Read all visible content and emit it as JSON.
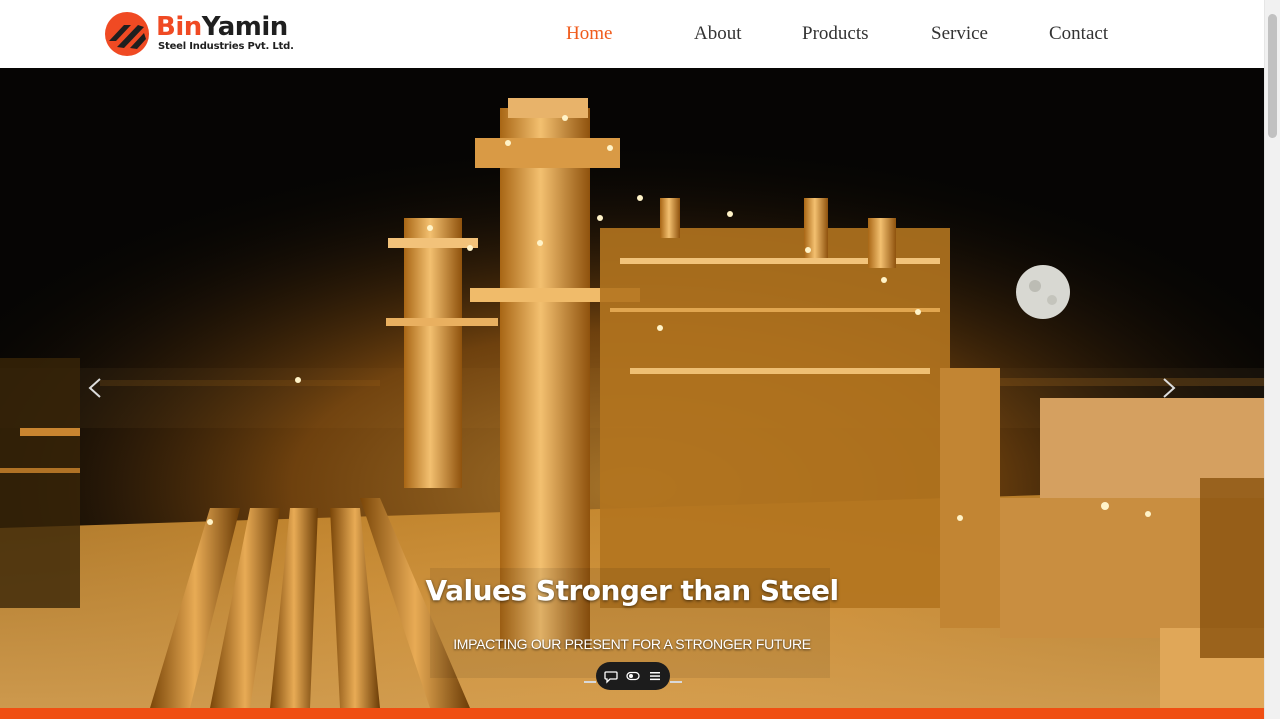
{
  "brand": {
    "name_part1": "Bin",
    "name_part2": "Yamin",
    "subtitle": "Steel Industries Pvt. Ltd."
  },
  "nav": {
    "items": [
      {
        "label": "Home",
        "active": true
      },
      {
        "label": "About",
        "active": false
      },
      {
        "label": "Products",
        "active": false
      },
      {
        "label": "Service",
        "active": false
      },
      {
        "label": "Contact",
        "active": false
      }
    ]
  },
  "hero": {
    "title": "Values Stronger than Steel",
    "subtitle": "IMPACTING OUR PRESENT FOR A STRONGER FUTURE",
    "prev_icon": "chevron-left-icon",
    "next_icon": "chevron-right-icon"
  },
  "floating_toolbar": {
    "icons": [
      "chat-icon",
      "toggle-icon",
      "menu-icon"
    ]
  },
  "colors": {
    "accent": "#f04e12",
    "nav_active": "#f05a1a",
    "nav_text": "#333333"
  }
}
